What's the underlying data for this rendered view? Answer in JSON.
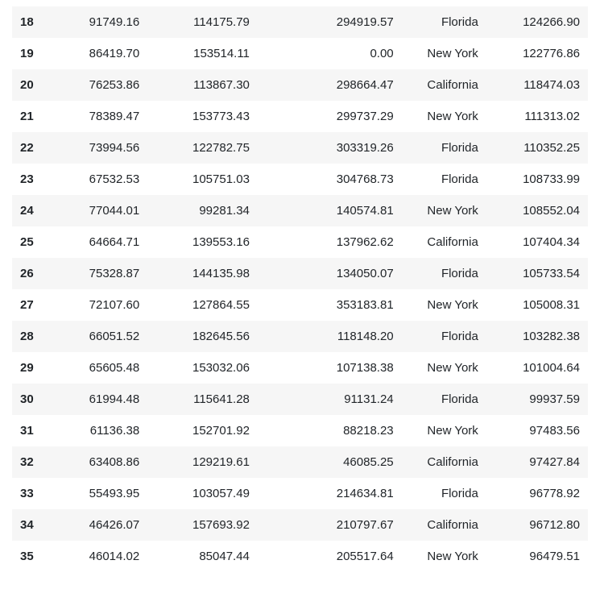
{
  "table": {
    "rows": [
      {
        "idx": "18",
        "c1": "91749.16",
        "c2": "114175.79",
        "c3": "294919.57",
        "c4": "Florida",
        "c5": "124266.90"
      },
      {
        "idx": "19",
        "c1": "86419.70",
        "c2": "153514.11",
        "c3": "0.00",
        "c4": "New York",
        "c5": "122776.86"
      },
      {
        "idx": "20",
        "c1": "76253.86",
        "c2": "113867.30",
        "c3": "298664.47",
        "c4": "California",
        "c5": "118474.03"
      },
      {
        "idx": "21",
        "c1": "78389.47",
        "c2": "153773.43",
        "c3": "299737.29",
        "c4": "New York",
        "c5": "111313.02"
      },
      {
        "idx": "22",
        "c1": "73994.56",
        "c2": "122782.75",
        "c3": "303319.26",
        "c4": "Florida",
        "c5": "110352.25"
      },
      {
        "idx": "23",
        "c1": "67532.53",
        "c2": "105751.03",
        "c3": "304768.73",
        "c4": "Florida",
        "c5": "108733.99"
      },
      {
        "idx": "24",
        "c1": "77044.01",
        "c2": "99281.34",
        "c3": "140574.81",
        "c4": "New York",
        "c5": "108552.04"
      },
      {
        "idx": "25",
        "c1": "64664.71",
        "c2": "139553.16",
        "c3": "137962.62",
        "c4": "California",
        "c5": "107404.34"
      },
      {
        "idx": "26",
        "c1": "75328.87",
        "c2": "144135.98",
        "c3": "134050.07",
        "c4": "Florida",
        "c5": "105733.54"
      },
      {
        "idx": "27",
        "c1": "72107.60",
        "c2": "127864.55",
        "c3": "353183.81",
        "c4": "New York",
        "c5": "105008.31"
      },
      {
        "idx": "28",
        "c1": "66051.52",
        "c2": "182645.56",
        "c3": "118148.20",
        "c4": "Florida",
        "c5": "103282.38"
      },
      {
        "idx": "29",
        "c1": "65605.48",
        "c2": "153032.06",
        "c3": "107138.38",
        "c4": "New York",
        "c5": "101004.64"
      },
      {
        "idx": "30",
        "c1": "61994.48",
        "c2": "115641.28",
        "c3": "91131.24",
        "c4": "Florida",
        "c5": "99937.59"
      },
      {
        "idx": "31",
        "c1": "61136.38",
        "c2": "152701.92",
        "c3": "88218.23",
        "c4": "New York",
        "c5": "97483.56"
      },
      {
        "idx": "32",
        "c1": "63408.86",
        "c2": "129219.61",
        "c3": "46085.25",
        "c4": "California",
        "c5": "97427.84"
      },
      {
        "idx": "33",
        "c1": "55493.95",
        "c2": "103057.49",
        "c3": "214634.81",
        "c4": "Florida",
        "c5": "96778.92"
      },
      {
        "idx": "34",
        "c1": "46426.07",
        "c2": "157693.92",
        "c3": "210797.67",
        "c4": "California",
        "c5": "96712.80"
      },
      {
        "idx": "35",
        "c1": "46014.02",
        "c2": "85047.44",
        "c3": "205517.64",
        "c4": "New York",
        "c5": "96479.51"
      }
    ]
  }
}
